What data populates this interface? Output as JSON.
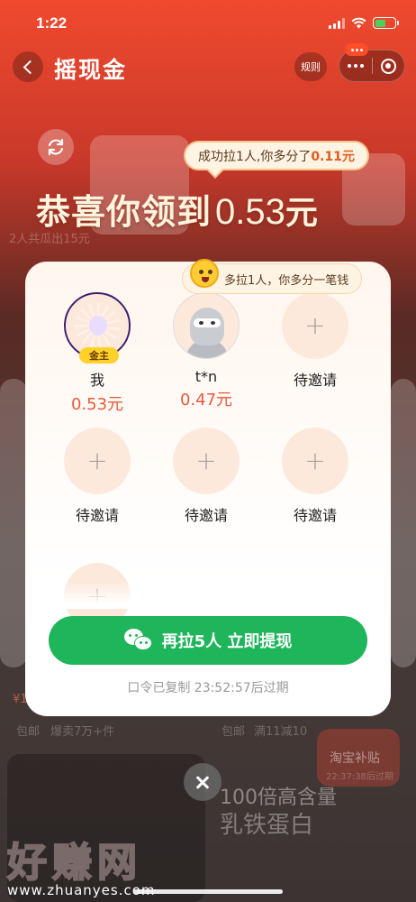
{
  "status_bar": {
    "time": "1:22"
  },
  "nav": {
    "title": "摇现金",
    "rules_label": "规则"
  },
  "banner": {
    "success_text_prefix": "成功拉1人,你多分了",
    "success_amount": "0.11元",
    "congrats_text": "恭喜你领到",
    "congrats_amount": "0.53",
    "congrats_unit": "元"
  },
  "modal": {
    "hint": "多拉1人，你多分一笔钱",
    "slots": [
      {
        "name": "我",
        "amount": "0.53元",
        "tag": "金主"
      },
      {
        "name": "t*n",
        "amount": "0.47元"
      },
      {
        "name": "待邀请"
      },
      {
        "name": "待邀请"
      },
      {
        "name": "待邀请"
      },
      {
        "name": "待邀请"
      }
    ],
    "cta_label": "再拉5人 立即提现",
    "expire_text": "口令已复制 23:52:57后过期"
  },
  "background": {
    "item_price": "¥1",
    "labels": [
      "2人共瓜出15元",
      "包邮",
      "爆卖7万+件",
      "包邮",
      "满11减10",
      "淘宝补贴",
      "22:37:38后过期",
      "100倍高含量",
      "乳铁蛋白"
    ]
  },
  "watermark": {
    "brand": "好赚网",
    "url": "www.zhuanyes.com"
  }
}
